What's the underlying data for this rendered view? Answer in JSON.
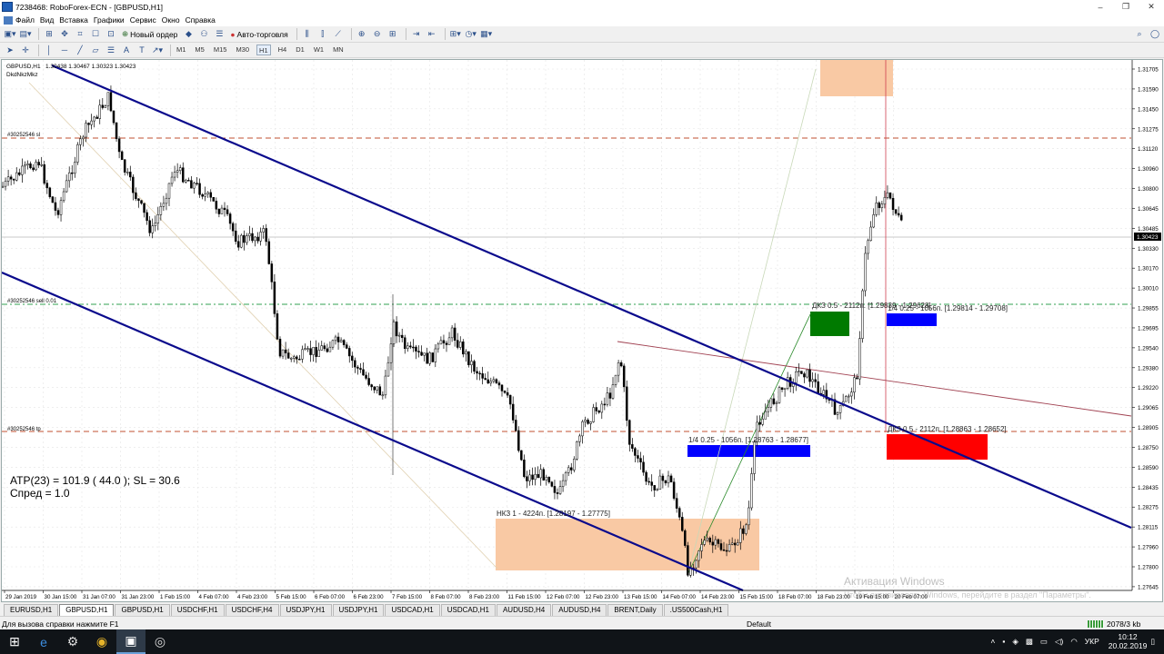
{
  "window": {
    "title": "7238468: RoboForex-ECN - [GBPUSD,H1]",
    "minimize": "–",
    "restore": "❐",
    "close": "✕"
  },
  "menu": [
    "Файл",
    "Вид",
    "Вставка",
    "Графики",
    "Сервис",
    "Окно",
    "Справка"
  ],
  "toolbar": {
    "new_order": "Новый ордер",
    "autotrading": "Авто-торговля",
    "timeframes": [
      "M1",
      "M5",
      "M15",
      "M30",
      "H1",
      "H4",
      "D1",
      "W1",
      "MN"
    ],
    "active_timeframe": "H1"
  },
  "chart": {
    "header_symbol": "GBPUSD,H1",
    "header_prices": "1.30438 1.30467 1.30323 1.30423",
    "indicator_name": "DkdNkzMkz",
    "current_price": "1.30423",
    "price_labels": [
      "1.31705",
      "1.31590",
      "1.31450",
      "1.31275",
      "1.31120",
      "1.30960",
      "1.30800",
      "1.30645",
      "1.30485",
      "1.30330",
      "1.30170",
      "1.30010",
      "1.29855",
      "1.29695",
      "1.29540",
      "1.29380",
      "1.29220",
      "1.29065",
      "1.28905",
      "1.28750",
      "1.28590",
      "1.28435",
      "1.28275",
      "1.28115",
      "1.27960",
      "1.27800",
      "1.27645"
    ],
    "time_labels": [
      "29 Jan 2019",
      "30 Jan 15:00",
      "31 Jan 07:00",
      "31 Jan 23:00",
      "1 Feb 15:00",
      "4 Feb 07:00",
      "4 Feb 23:00",
      "5 Feb 15:00",
      "6 Feb 07:00",
      "6 Feb 23:00",
      "7 Feb 15:00",
      "8 Feb 07:00",
      "8 Feb 23:00",
      "11 Feb 15:00",
      "12 Feb 07:00",
      "12 Feb 23:00",
      "13 Feb 15:00",
      "14 Feb 07:00",
      "14 Feb 23:00",
      "15 Feb 15:00",
      "18 Feb 07:00",
      "18 Feb 23:00",
      "19 Feb 15:00",
      "20 Feb 07:00"
    ],
    "order_sl_label": "#30252546 sl",
    "order_sell_label": "#30252546 sell 0.01",
    "order_tp_label": "#30252546 tp",
    "atr_text": "ATP(23) = 101.9 ( 44.0 ); SL = 30.6",
    "spread_text": "Спред = 1.0",
    "zone_nkz": "НКЗ 1 - 4224п. [1.28197 - 1.27775]",
    "zone_quarter_low": "1/4 0.25 - 1056п. [1.28763 - 1.28677]",
    "zone_dkz_upper": "ДКЗ 0.5 - 2112п. [1.29839 - 1.29628]",
    "zone_quarter_upper": "1/4 0.25 - 1056п. [1.29814 - 1.29708]",
    "zone_dkz_lower": "ДКЗ 0.5 - 2112п. [1.28863 - 1.28652]",
    "watermark_title": "Активация Windows",
    "watermark_sub": "Чтобы активировать Windows, перейдите в раздел \"Параметры\".",
    "colors": {
      "channel": "#0a0a8c",
      "candle": "#000000",
      "nkz_zone": "#f9c9a4",
      "quarter_zone": "#0000ff",
      "dkz_upper": "#007a00",
      "dkz_lower": "#ff0000",
      "trendline": "#a04050"
    }
  },
  "tabs": [
    "EURUSD,H1",
    "GBPUSD,H1",
    "GBPUSD,H1",
    "USDCHF,H1",
    "USDCHF,H4",
    "USDJPY,H1",
    "USDJPY,H1",
    "USDCAD,H1",
    "USDCAD,H1",
    "AUDUSD,H4",
    "AUDUSD,H4",
    "BRENT,Daily",
    ".US500Cash,H1"
  ],
  "active_tab": 1,
  "status": {
    "help": "Для вызова справки нажмите F1",
    "profile": "Default",
    "traffic": "2078/3 kb"
  },
  "taskbar": {
    "lang": "УКР",
    "time": "10:12",
    "date": "20.02.2019"
  }
}
